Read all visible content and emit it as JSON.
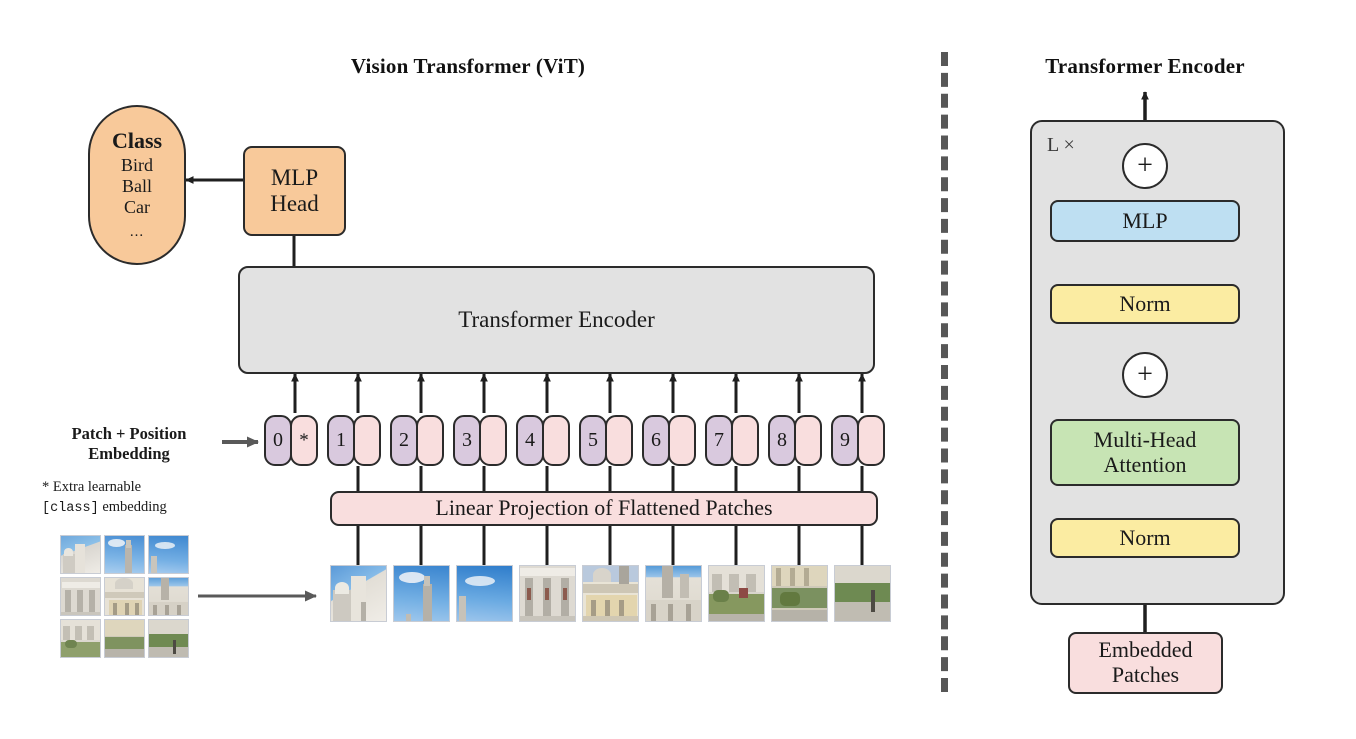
{
  "figure": {
    "left_title": "Vision Transformer (ViT)",
    "right_title": "Transformer Encoder"
  },
  "left_panel": {
    "class_box": {
      "heading": "Class",
      "items": [
        "Bird",
        "Ball",
        "Car"
      ],
      "ellipsis": "...",
      "color": "#f8c99a"
    },
    "mlp_head": {
      "line1": "MLP",
      "line2": "Head",
      "color": "#f8c99a"
    },
    "encoder_box": {
      "label": "Transformer Encoder",
      "color": "#e2e2e2"
    },
    "linear_projection": {
      "label": "Linear Projection of Flattened Patches",
      "color": "#f9dede"
    },
    "embedding_label": {
      "line1": "Patch + Position",
      "line2": "Embedding"
    },
    "footnote": {
      "line1": "* Extra learnable",
      "line2_mono": "[class]",
      "line2_rest": " embedding"
    },
    "tokens": {
      "star": "*",
      "numbers": [
        "0",
        "1",
        "2",
        "3",
        "4",
        "5",
        "6",
        "7",
        "8",
        "9"
      ],
      "pos_color": "#d9c9de",
      "patch_color": "#f9dede"
    }
  },
  "right_panel": {
    "repeat_label": "L ×",
    "blocks": [
      {
        "name": "mlp",
        "label": "MLP",
        "color": "#bedff2"
      },
      {
        "name": "norm-top",
        "label": "Norm",
        "color": "#fbeca2"
      },
      {
        "name": "multi-head-attention",
        "line1": "Multi-Head",
        "line2": "Attention",
        "color": "#c7e4b4"
      },
      {
        "name": "norm-bottom",
        "label": "Norm",
        "color": "#fbeca2"
      },
      {
        "name": "embedded-patches",
        "line1": "Embedded",
        "line2": "Patches",
        "color": "#f9dede"
      }
    ],
    "adders": [
      "+",
      "+"
    ],
    "outer_color": "#e2e2e2"
  },
  "divider": {
    "style": "dashed-vertical",
    "color": "#575757"
  },
  "colors": {
    "stroke": "#2b2b2b",
    "gray_fill": "#e2e2e2",
    "pink_fill": "#f9dede",
    "orange_fill": "#f8c99a",
    "purple_fill": "#d9c9de",
    "blue_fill": "#bedff2",
    "yellow_fill": "#fbeca2",
    "green_fill": "#c7e4b4",
    "background": "#ffffff"
  }
}
